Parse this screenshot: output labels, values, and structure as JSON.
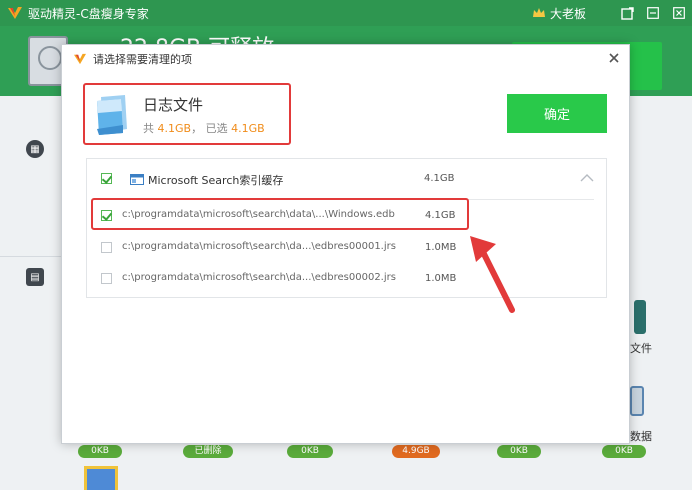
{
  "app": {
    "title": "驱动精灵-C盘瘦身专家",
    "boss_label": "大老板",
    "bg_headline": "22.8GB 可释放",
    "bg_right_label_1": "文件",
    "bg_right_label_2": "数据",
    "bottom_pills": [
      "0KB",
      "已删除",
      "0KB",
      "4.9GB",
      "0KB",
      "0KB"
    ]
  },
  "dialog": {
    "title": "请选择需要清理的项",
    "summary": {
      "title": "日志文件",
      "total_prefix": "共",
      "total_value": "4.1GB",
      "separator": "，",
      "selected_prefix": "已选",
      "selected_value": "4.1GB"
    },
    "confirm_label": "确定",
    "group": {
      "label": "Microsoft Search索引缓存",
      "size": "4.1GB",
      "checked": true
    },
    "items": [
      {
        "path": "c:\\programdata\\microsoft\\search\\data\\...\\Windows.edb",
        "size": "4.1GB",
        "checked": true
      },
      {
        "path": "c:\\programdata\\microsoft\\search\\da...\\edbres00001.jrs",
        "size": "1.0MB",
        "checked": false
      },
      {
        "path": "c:\\programdata\\microsoft\\search\\da...\\edbres00002.jrs",
        "size": "1.0MB",
        "checked": false
      }
    ]
  },
  "colors": {
    "brand_green": "#2e9650",
    "confirm_green": "#29c94a",
    "highlight_red": "#e23a3a",
    "accent_orange": "#f08c1a"
  },
  "icons": {
    "app_logo": "v-logo-icon",
    "close": "close-icon",
    "log_file": "log-file-icon",
    "collapse": "chevron-up-icon"
  }
}
